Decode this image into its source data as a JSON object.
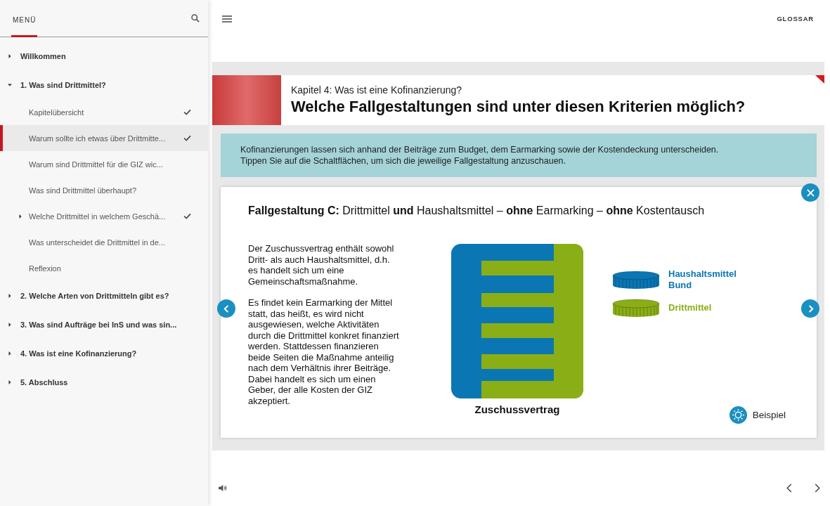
{
  "sidebar": {
    "tab": "MENÜ",
    "items": [
      {
        "label": "Willkommen",
        "expanded": false
      },
      {
        "label": "1. Was sind Drittmittel?",
        "expanded": true,
        "children": [
          {
            "label": "Kapitelübersicht",
            "kind": "page",
            "checked": true,
            "selected": false
          },
          {
            "label": "Warum sollte ich etwas über Drittmitte...",
            "kind": "page",
            "checked": true,
            "selected": true
          },
          {
            "label": "Warum sind Drittmittel für die GIZ wic...",
            "kind": "page",
            "checked": false,
            "selected": false
          },
          {
            "label": "Was sind Drittmittel überhaupt?",
            "kind": "page",
            "checked": false,
            "selected": false
          },
          {
            "label": "Welche Drittmittel in welchem Geschä...",
            "kind": "group",
            "expanded": false,
            "checked": true,
            "selected": false
          },
          {
            "label": "Was unterscheidet die Drittmittel in de...",
            "kind": "page",
            "checked": false,
            "selected": false
          },
          {
            "label": "Reflexion",
            "kind": "page",
            "checked": false,
            "selected": false
          }
        ]
      },
      {
        "label": "2. Welche Arten von Drittmitteln gibt es?",
        "expanded": false
      },
      {
        "label": "3. Was sind Aufträge bei InS und was sin...",
        "expanded": false
      },
      {
        "label": "4. Was ist eine Kofinanzierung?",
        "expanded": false
      },
      {
        "label": "5. Abschluss",
        "expanded": false
      }
    ]
  },
  "topbar": {
    "glossary": "GLOSSAR"
  },
  "slide": {
    "chapter": "Kapitel 4: Was ist eine Kofinanzierung?",
    "title": "Welche Fallgestaltungen sind unter diesen Kriterien möglich?",
    "info": [
      "Kofinanzierungen lassen sich anhand der Beiträge zum Budget, dem Earmarking sowie der Kostendeckung unterscheiden.",
      "Tippen Sie auf die Schaltflächen, um sich die jeweilige Fallgestaltung anzuschauen."
    ],
    "card": {
      "heading": "**Fallgestaltung C:** Drittmittel **und** Haushaltsmittel – **ohne** Earmarking – **ohne** Kostentausch",
      "paragraphs": [
        "Der Zuschussvertrag enthält sowohl Dritt- als auch Haushaltsmittel, d.h. es handelt sich um eine Gemeinschaftsmaßnahme.",
        "Es findet kein Earmarking der Mittel statt, das heißt, es wird nicht ausgewiesen, welche Aktivitäten durch die Drittmittel konkret finanziert werden. Stattdessen finanzieren beide Seiten die Maßnahme anteilig nach dem Verhältnis ihrer Beiträge. Dabei handelt es sich um einen Geber, der alle Kosten der GIZ akzeptiert."
      ],
      "diagram_label": "Zuschussvertrag",
      "legend": [
        {
          "label": "Haushaltsmittel Bund",
          "color": "#0a76b3"
        },
        {
          "label": "Drittmittel",
          "color": "#8aae16"
        }
      ],
      "example": "Beispiel"
    }
  }
}
